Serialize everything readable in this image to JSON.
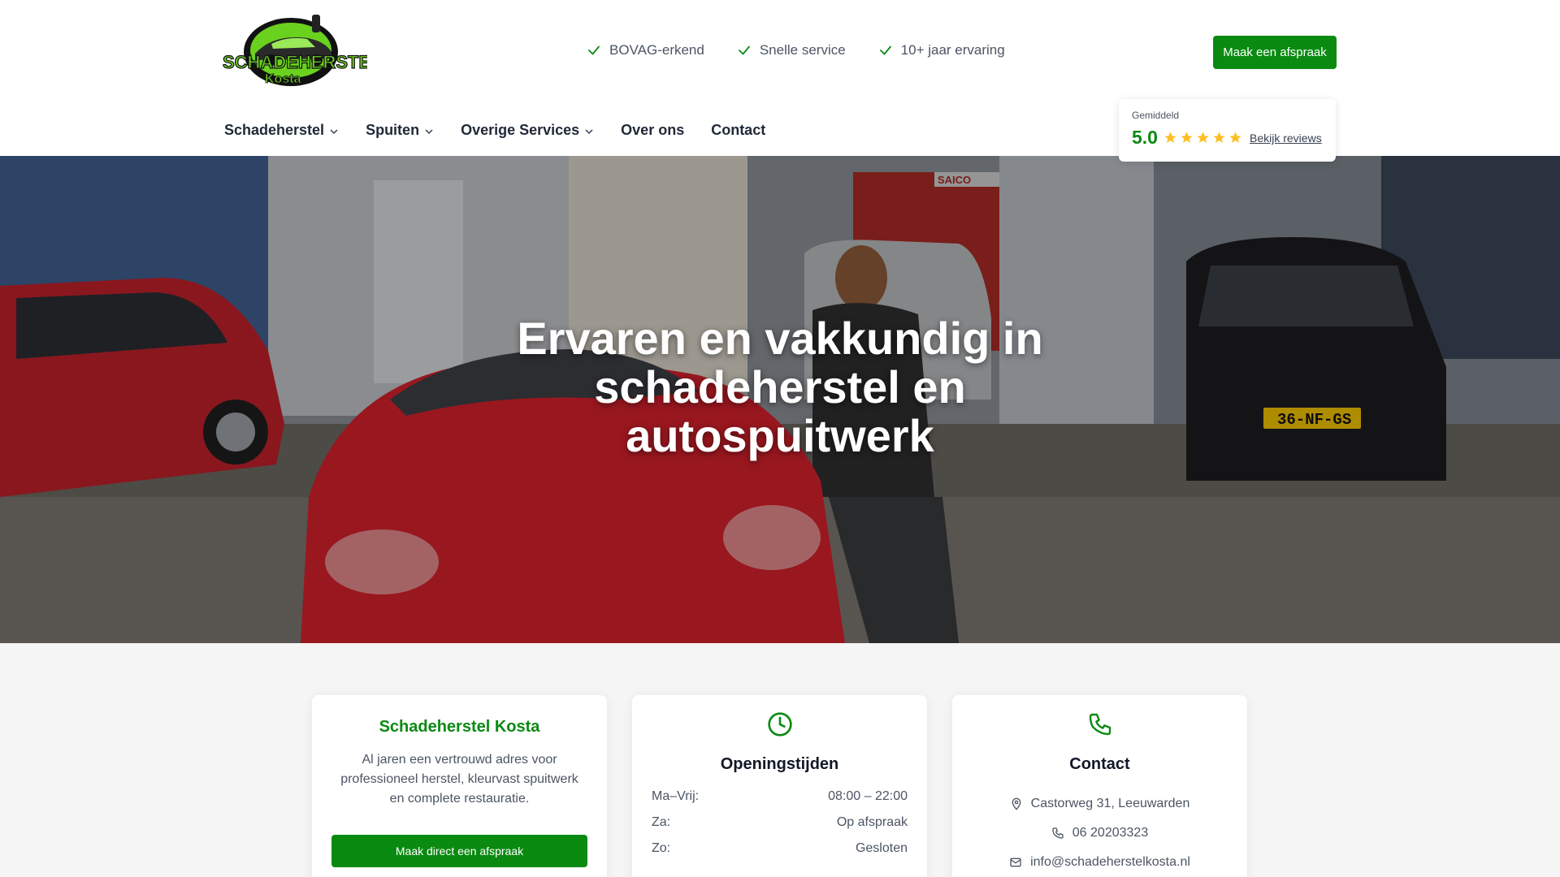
{
  "header": {
    "logo": {
      "line1": "SCHADEHERSTEL",
      "line2": "Kosta"
    },
    "usps": [
      "BOVAG-erkend",
      "Snelle service",
      "10+ jaar ervaring"
    ],
    "cta_label": "Maak een afspraak",
    "nav": [
      "Schadeherstel",
      "Spuiten",
      "Overige Services",
      "Over ons",
      "Contact"
    ],
    "rating": {
      "label": "Gemiddeld",
      "score": "5.0",
      "stars": 5,
      "link": "Bekijk reviews"
    }
  },
  "hero": {
    "title": "Ervaren en vakkundig in schadeherstel en autospuitwerk",
    "sign_text": "SAICO",
    "plate_text": "36-NF-GS"
  },
  "cards": {
    "about": {
      "title": "Schadeherstel Kosta",
      "text": "Al jaren een vertrouwd adres voor professioneel herstel, kleurvast spuitwerk en complete restauratie.",
      "button": "Maak direct een afspraak"
    },
    "hours": {
      "title": "Openingstijden",
      "rows": [
        {
          "day": "Ma–Vrij:",
          "time": "08:00 – 22:00"
        },
        {
          "day": "Za:",
          "time": "Op afspraak"
        },
        {
          "day": "Zo:",
          "time": "Gesloten"
        }
      ]
    },
    "contact": {
      "title": "Contact",
      "address": "Castorweg 31, Leeuwarden",
      "phone": "06 20203323",
      "email": "info@schadeherstelkosta.nl"
    }
  },
  "colors": {
    "brand_green": "#0b8a12",
    "star_yellow": "#fbbf24",
    "text_dark": "#1f2937"
  },
  "icons": [
    "check-icon",
    "chevron-down-icon",
    "star-icon",
    "clock-icon",
    "phone-icon",
    "map-pin-icon",
    "mail-icon"
  ]
}
